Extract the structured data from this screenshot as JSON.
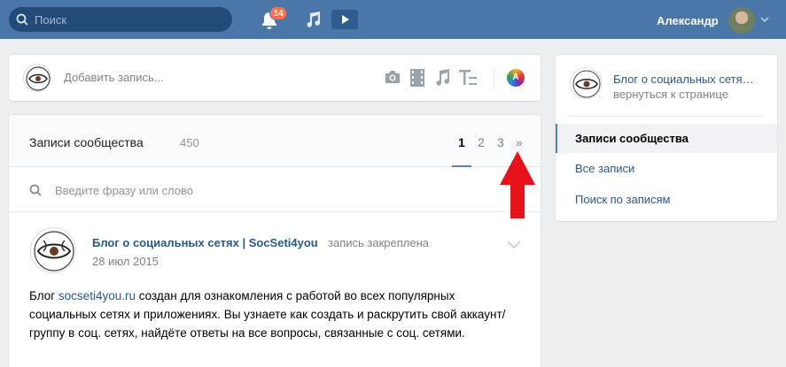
{
  "header": {
    "search_placeholder": "Поиск",
    "notifications_count": "14",
    "user_name": "Александр",
    "bg_color": "#4a76a8"
  },
  "composer": {
    "placeholder": "Добавить запись...",
    "avatar_letter": "A"
  },
  "wall": {
    "title": "Записи сообщества",
    "count": "450",
    "pages": [
      "1",
      "2",
      "3",
      "»"
    ],
    "active_page": "1",
    "search_placeholder": "Введите фразу или слово"
  },
  "post": {
    "author": "Блог о социальных сетях | SocSeti4you",
    "pinned_label": "запись закреплена",
    "date": "28 июл 2015",
    "link_text": "socseti4you.ru",
    "text_before_link": "Блог ",
    "text_after_link": " создан для ознакомления с работой во всех популярных социальных сетях и приложениях. Вы узнаете как создать и раскрутить свой аккаунт/группу в соц. сетях, найдёте ответы на все вопросы, связанные с соц. сетями."
  },
  "sidebar": {
    "community_name": "Блог о социальных сетя…",
    "back_link": "вернуться к странице",
    "items": [
      {
        "label": "Записи сообщества",
        "active": true
      },
      {
        "label": "Все записи",
        "active": false
      },
      {
        "label": "Поиск по записям",
        "active": false
      }
    ]
  },
  "colors": {
    "link": "#2a5885",
    "accent": "#5181b8",
    "annotation_arrow": "#e8131a",
    "badge": "#ff734c"
  }
}
